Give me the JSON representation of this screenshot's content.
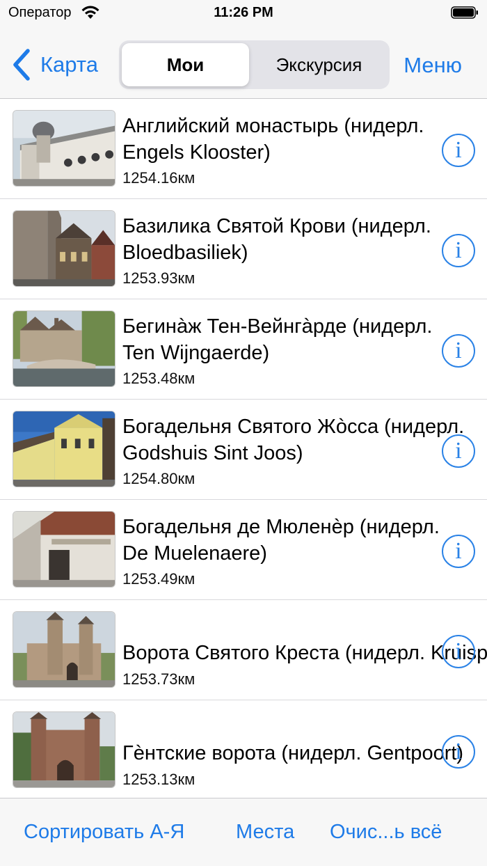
{
  "status_bar": {
    "carrier": "Оператор",
    "time": "11:26 PM"
  },
  "nav": {
    "back_label": "Карта",
    "segments": [
      "Мои",
      "Экскурсия"
    ],
    "selected_segment": "Мои",
    "menu_label": "Меню"
  },
  "items": [
    {
      "title": "Английский монастырь (нидерл.\nEngels Klooster)",
      "distance": "1254.16км"
    },
    {
      "title": "Базилика Святой Крови (нидерл.\nBloedbasiliek)",
      "distance": "1253.93км"
    },
    {
      "title": "Бегинàж Тен-Вейнгàрде (нидерл.\nTen Wijngaerde)",
      "distance": "1253.48км"
    },
    {
      "title": "Богадельня Святого Жòсса (нидерл.\nGodshuis Sint Joos)",
      "distance": "1254.80км"
    },
    {
      "title": "Богадельня де Мюленèр (нидерл.\nDe Muelenaere)",
      "distance": "1253.49км"
    },
    {
      "title": "Ворота Святого Креста (нидерл. Kruispoort)",
      "distance": "1253.73км"
    },
    {
      "title": "Гѐнтские ворота (нидерл. Gentpoort)",
      "distance": "1253.13км"
    }
  ],
  "info_glyph": "i",
  "toolbar": {
    "sort_label": "Сортировать А-Я",
    "places_label": "Места",
    "clear_label": "Очис...ь всё"
  },
  "colors": {
    "accent": "#1e7be8",
    "bar_background": "#f7f7f7",
    "separator": "#d8d8dc"
  }
}
